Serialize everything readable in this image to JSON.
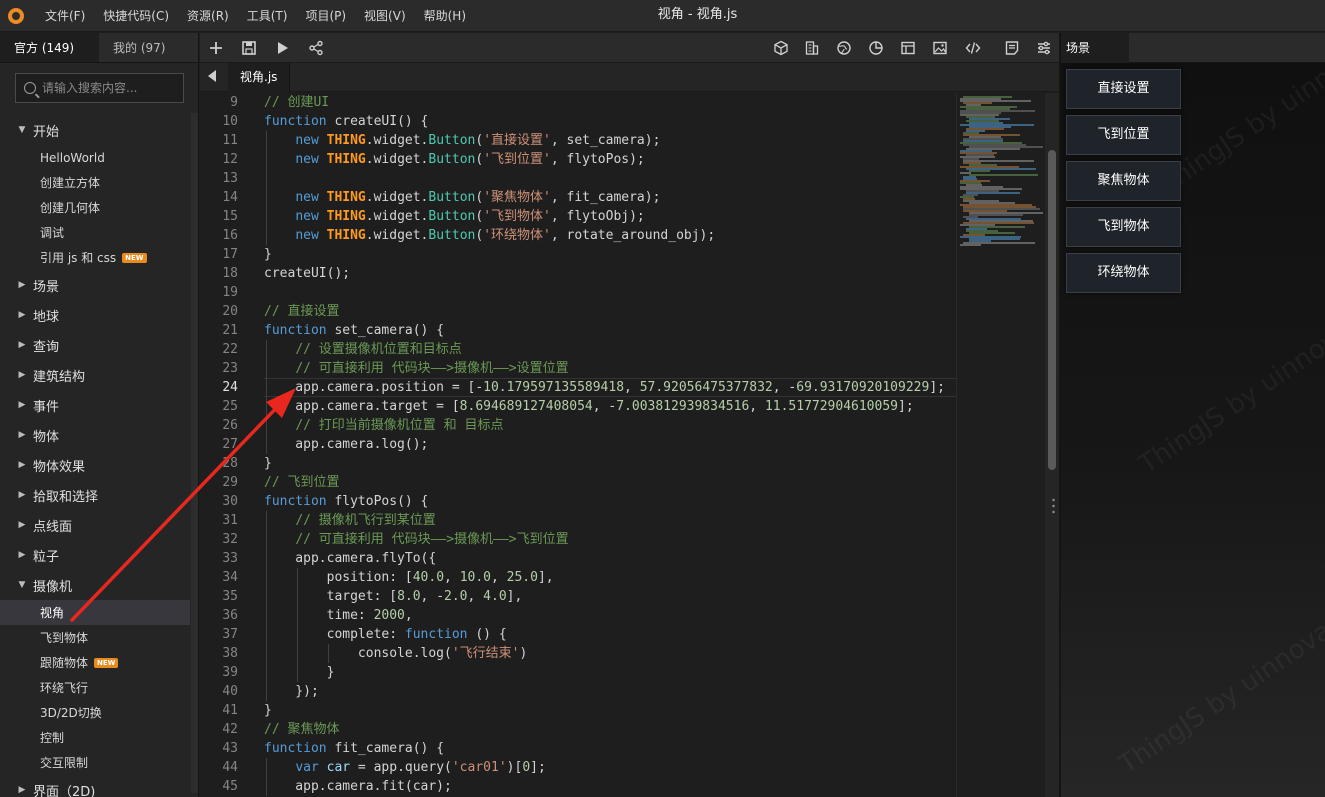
{
  "menubar": {
    "items": [
      "文件(F)",
      "快捷代码(C)",
      "资源(R)",
      "工具(T)",
      "项目(P)",
      "视图(V)",
      "帮助(H)"
    ],
    "window_title": "视角 -  视角.js"
  },
  "sidebar": {
    "tabs": [
      "官方 (149)",
      "我的 (97)"
    ],
    "search_placeholder": "请输入搜索内容...",
    "tree": [
      {
        "type": "group",
        "label": "开始",
        "expanded": true
      },
      {
        "type": "child",
        "label": "HelloWorld"
      },
      {
        "type": "child",
        "label": "创建立方体"
      },
      {
        "type": "child",
        "label": "创建几何体"
      },
      {
        "type": "child",
        "label": "调试"
      },
      {
        "type": "child",
        "label": "引用 js 和 css",
        "badge": "NEW"
      },
      {
        "type": "group",
        "label": "场景",
        "expanded": false
      },
      {
        "type": "group",
        "label": "地球",
        "expanded": false
      },
      {
        "type": "group",
        "label": "查询",
        "expanded": false
      },
      {
        "type": "group",
        "label": "建筑结构",
        "expanded": false
      },
      {
        "type": "group",
        "label": "事件",
        "expanded": false
      },
      {
        "type": "group",
        "label": "物体",
        "expanded": false
      },
      {
        "type": "group",
        "label": "物体效果",
        "expanded": false
      },
      {
        "type": "group",
        "label": "拾取和选择",
        "expanded": false
      },
      {
        "type": "group",
        "label": "点线面",
        "expanded": false
      },
      {
        "type": "group",
        "label": "粒子",
        "expanded": false
      },
      {
        "type": "group",
        "label": "摄像机",
        "expanded": true
      },
      {
        "type": "child",
        "label": "视角",
        "selected": true
      },
      {
        "type": "child",
        "label": "飞到物体"
      },
      {
        "type": "child",
        "label": "跟随物体",
        "badge": "NEW"
      },
      {
        "type": "child",
        "label": "环绕飞行"
      },
      {
        "type": "child",
        "label": "3D/2D切换"
      },
      {
        "type": "child",
        "label": "控制"
      },
      {
        "type": "child",
        "label": "交互限制"
      },
      {
        "type": "group",
        "label": "界面（2D)",
        "expanded": false
      }
    ]
  },
  "editor": {
    "toolbar_icons": [
      "plus-icon",
      "save-icon",
      "play-icon",
      "share-icon",
      "cube-icon",
      "building-icon",
      "globe-icon",
      "chart-icon",
      "layout-icon",
      "image-icon",
      "code-icon",
      "notes-icon",
      "settings-icon"
    ],
    "file_tab": "视角.js",
    "active_line": 24,
    "lines": [
      {
        "n": 9,
        "html": "<span class=\"cm\">// 创建UI</span>"
      },
      {
        "n": 10,
        "html": "<span class=\"kw\">function</span> createUI() {"
      },
      {
        "n": 11,
        "html": "    <span class=\"kw\">new</span> <span class=\"th\">THING</span>.widget.<span class=\"fn\">Button</span>(<span class=\"st\">'直接设置'</span>, set_camera);"
      },
      {
        "n": 12,
        "html": "    <span class=\"kw\">new</span> <span class=\"th\">THING</span>.widget.<span class=\"fn\">Button</span>(<span class=\"st\">'飞到位置'</span>, flytoPos);"
      },
      {
        "n": 13,
        "html": ""
      },
      {
        "n": 14,
        "html": "    <span class=\"kw\">new</span> <span class=\"th\">THING</span>.widget.<span class=\"fn\">Button</span>(<span class=\"st\">'聚焦物体'</span>, fit_camera);"
      },
      {
        "n": 15,
        "html": "    <span class=\"kw\">new</span> <span class=\"th\">THING</span>.widget.<span class=\"fn\">Button</span>(<span class=\"st\">'飞到物体'</span>, flytoObj);"
      },
      {
        "n": 16,
        "html": "    <span class=\"kw\">new</span> <span class=\"th\">THING</span>.widget.<span class=\"fn\">Button</span>(<span class=\"st\">'环绕物体'</span>, rotate_around_obj);"
      },
      {
        "n": 17,
        "html": "}"
      },
      {
        "n": 18,
        "html": "createUI();"
      },
      {
        "n": 19,
        "html": ""
      },
      {
        "n": 20,
        "html": "<span class=\"cm\">// 直接设置</span>"
      },
      {
        "n": 21,
        "html": "<span class=\"kw\">function</span> set_camera() {"
      },
      {
        "n": 22,
        "html": "    <span class=\"cm\">// 设置摄像机位置和目标点</span>"
      },
      {
        "n": 23,
        "html": "    <span class=\"cm\">// 可直接利用 代码块——&gt;摄像机——&gt;设置位置</span>"
      },
      {
        "n": 24,
        "html": "    app.camera.position = [-<span class=\"nu\">10.179597135589418</span>, <span class=\"nu\">57.92056475377832</span>, -<span class=\"nu\">69.93170920109229</span>];"
      },
      {
        "n": 25,
        "html": "    app.camera.target = [<span class=\"nu\">8.694689127408054</span>, -<span class=\"nu\">7.003812939834516</span>, <span class=\"nu\">11.51772904610059</span>];"
      },
      {
        "n": 26,
        "html": "    <span class=\"cm\">// 打印当前摄像机位置 和 目标点</span>"
      },
      {
        "n": 27,
        "html": "    app.camera.log();"
      },
      {
        "n": 28,
        "html": "}"
      },
      {
        "n": 29,
        "html": "<span class=\"cm\">// 飞到位置</span>"
      },
      {
        "n": 30,
        "html": "<span class=\"kw\">function</span> flytoPos() {"
      },
      {
        "n": 31,
        "html": "    <span class=\"cm\">// 摄像机飞行到某位置</span>"
      },
      {
        "n": 32,
        "html": "    <span class=\"cm\">// 可直接利用 代码块——&gt;摄像机——&gt;飞到位置</span>"
      },
      {
        "n": 33,
        "html": "    app.camera.flyTo({"
      },
      {
        "n": 34,
        "html": "        position: [<span class=\"nu\">40.0</span>, <span class=\"nu\">10.0</span>, <span class=\"nu\">25.0</span>],"
      },
      {
        "n": 35,
        "html": "        target: [<span class=\"nu\">8.0</span>, -<span class=\"nu\">2.0</span>, <span class=\"nu\">4.0</span>],"
      },
      {
        "n": 36,
        "html": "        time: <span class=\"nu\">2000</span>,"
      },
      {
        "n": 37,
        "html": "        complete: <span class=\"kw\">function</span> () {"
      },
      {
        "n": 38,
        "html": "            console.log(<span class=\"st\">'飞行结束'</span>)"
      },
      {
        "n": 39,
        "html": "        }"
      },
      {
        "n": 40,
        "html": "    });"
      },
      {
        "n": 41,
        "html": "}"
      },
      {
        "n": 42,
        "html": "<span class=\"cm\">// 聚焦物体</span>"
      },
      {
        "n": 43,
        "html": "<span class=\"kw\">function</span> fit_camera() {"
      },
      {
        "n": 44,
        "html": "    <span class=\"kw\">var</span> <span class=\"pr\">car</span> = app.query(<span class=\"st\">'car01'</span>)[<span class=\"nu\">0</span>];"
      },
      {
        "n": 45,
        "html": "    app.camera.fit(car);"
      }
    ]
  },
  "scene": {
    "tab": "场景",
    "buttons": [
      "直接设置",
      "飞到位置",
      "聚焦物体",
      "飞到物体",
      "环绕物体"
    ],
    "watermark": "ThingJS by uinnova"
  },
  "colors": {
    "annotation_arrow": "#e8271f",
    "new_badge": "#e88a1c",
    "thing_keyword": "#ff9a1f"
  }
}
